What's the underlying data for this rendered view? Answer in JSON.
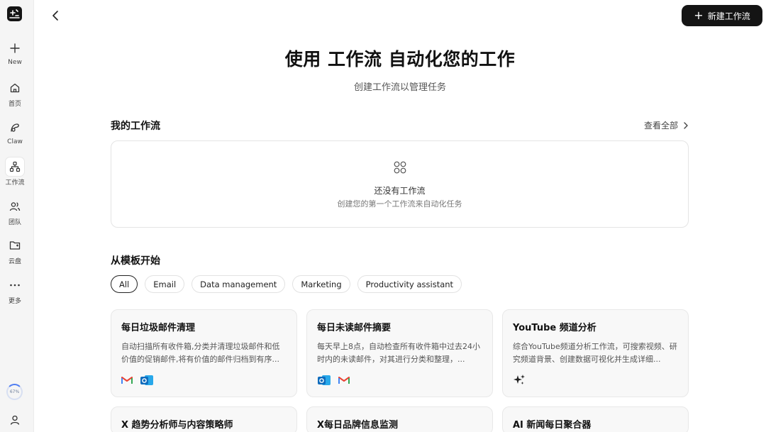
{
  "sidebar": {
    "items": [
      {
        "label": "New",
        "icon": "plus-icon"
      },
      {
        "label": "首页",
        "icon": "home-icon"
      },
      {
        "label": "Claw",
        "icon": "claw-icon"
      },
      {
        "label": "工作流",
        "icon": "workflow-icon",
        "active": true
      },
      {
        "label": "团队",
        "icon": "team-icon"
      },
      {
        "label": "云盘",
        "icon": "cloud-drive-icon"
      },
      {
        "label": "更多",
        "icon": "more-icon"
      }
    ],
    "usage": "67%"
  },
  "topbar": {
    "new_workflow_label": "新建工作流"
  },
  "hero": {
    "title": "使用 工作流 自动化您的工作",
    "subtitle": "创建工作流以管理任务"
  },
  "my_workflows": {
    "title": "我的工作流",
    "view_all": "查看全部",
    "empty_title": "还没有工作流",
    "empty_subtitle": "创建您的第一个工作流来自动化任务"
  },
  "templates": {
    "title": "从模板开始",
    "filters": [
      "All",
      "Email",
      "Data management",
      "Marketing",
      "Productivity assistant"
    ],
    "active_filter": "All",
    "cards": [
      {
        "title": "每日垃圾邮件清理",
        "desc": "自动扫描所有收件箱,分类并清理垃圾邮件和低价值的促销邮件,将有价值的邮件归档到有序...",
        "icons": [
          "gmail-icon",
          "outlook-icon"
        ]
      },
      {
        "title": "每日未读邮件摘要",
        "desc": "每天早上8点，自动检查所有收件箱中过去24小时内的未读邮件，对其进行分类和整理，...",
        "icons": [
          "outlook-icon",
          "gmail-icon"
        ]
      },
      {
        "title": "YouTube 频道分析",
        "desc": "综合YouTube频道分析工作流，可搜索视频、研究频道背景、创建数据可视化并生成详细...",
        "icons": [
          "sparkle-icon"
        ]
      },
      {
        "title": "X 趋势分析师与内容策略师",
        "desc": "",
        "icons": []
      },
      {
        "title": "X每日品牌信息监测",
        "desc": "",
        "icons": []
      },
      {
        "title": "AI 新闻每日聚合器",
        "desc": "",
        "icons": []
      }
    ]
  },
  "colors": {
    "primary_button": "#141414",
    "gmail_red": "#EA4335",
    "outlook_blue": "#0F6CBD"
  }
}
